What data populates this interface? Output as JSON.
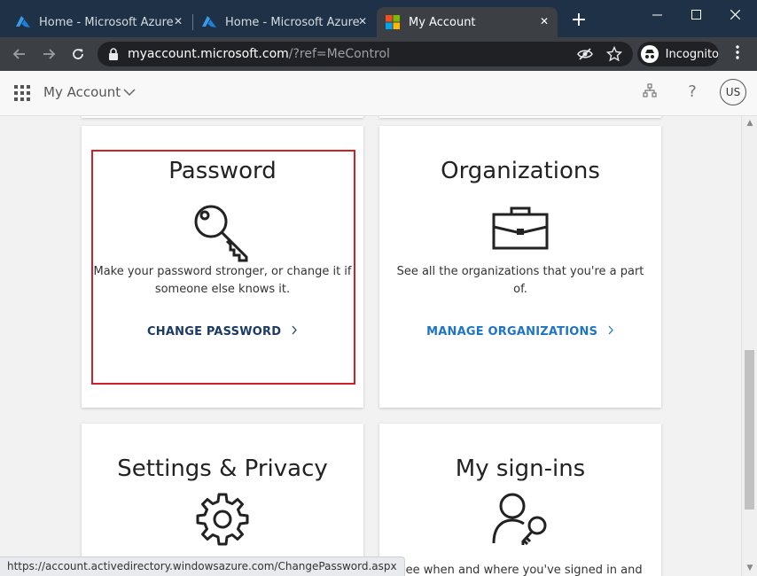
{
  "browser": {
    "tabs": [
      {
        "label": "Home - Microsoft Azure",
        "active": false
      },
      {
        "label": "Home - Microsoft Azure",
        "active": false
      },
      {
        "label": "My Account",
        "active": true
      }
    ],
    "url_host": "myaccount.microsoft.com",
    "url_path": "/?ref=MeControl",
    "incognito_label": "Incognito",
    "colors": {
      "titlebar": "#1f3146",
      "toolbar": "#3c3f44",
      "omnibox": "#202124"
    }
  },
  "app_header": {
    "title": "My Account",
    "avatar_initials": "US",
    "help_label": "?"
  },
  "cards": {
    "password": {
      "title": "Password",
      "description": "Make your password stronger, or change it if someone else knows it.",
      "link": "CHANGE PASSWORD",
      "icon": "key-icon",
      "link_color": "#1b3a66"
    },
    "organizations": {
      "title": "Organizations",
      "description": "See all the organizations that you're a part of.",
      "link": "MANAGE ORGANIZATIONS",
      "icon": "briefcase-icon",
      "link_color": "#1e74c6"
    },
    "settings": {
      "title": "Settings & Privacy",
      "icon": "gear-icon"
    },
    "signins": {
      "title": "My sign-ins",
      "description": "See when and where you've signed in and",
      "icon": "user-key-icon"
    }
  },
  "highlight_color": "#d0202a",
  "status_url": "https://account.activedirectory.windowsazure.com/ChangePassword.aspx"
}
